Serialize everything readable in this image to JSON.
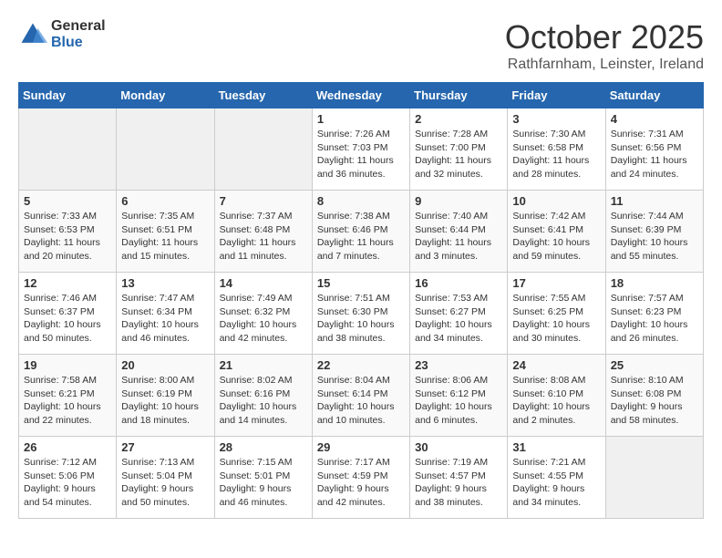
{
  "header": {
    "logo_general": "General",
    "logo_blue": "Blue",
    "month_title": "October 2025",
    "location": "Rathfarnham, Leinster, Ireland"
  },
  "days_of_week": [
    "Sunday",
    "Monday",
    "Tuesday",
    "Wednesday",
    "Thursday",
    "Friday",
    "Saturday"
  ],
  "weeks": [
    [
      {
        "num": "",
        "empty": true
      },
      {
        "num": "",
        "empty": true
      },
      {
        "num": "",
        "empty": true
      },
      {
        "num": "1",
        "sunrise": "7:26 AM",
        "sunset": "7:03 PM",
        "daylight": "11 hours and 36 minutes."
      },
      {
        "num": "2",
        "sunrise": "7:28 AM",
        "sunset": "7:00 PM",
        "daylight": "11 hours and 32 minutes."
      },
      {
        "num": "3",
        "sunrise": "7:30 AM",
        "sunset": "6:58 PM",
        "daylight": "11 hours and 28 minutes."
      },
      {
        "num": "4",
        "sunrise": "7:31 AM",
        "sunset": "6:56 PM",
        "daylight": "11 hours and 24 minutes."
      }
    ],
    [
      {
        "num": "5",
        "sunrise": "7:33 AM",
        "sunset": "6:53 PM",
        "daylight": "11 hours and 20 minutes."
      },
      {
        "num": "6",
        "sunrise": "7:35 AM",
        "sunset": "6:51 PM",
        "daylight": "11 hours and 15 minutes."
      },
      {
        "num": "7",
        "sunrise": "7:37 AM",
        "sunset": "6:48 PM",
        "daylight": "11 hours and 11 minutes."
      },
      {
        "num": "8",
        "sunrise": "7:38 AM",
        "sunset": "6:46 PM",
        "daylight": "11 hours and 7 minutes."
      },
      {
        "num": "9",
        "sunrise": "7:40 AM",
        "sunset": "6:44 PM",
        "daylight": "11 hours and 3 minutes."
      },
      {
        "num": "10",
        "sunrise": "7:42 AM",
        "sunset": "6:41 PM",
        "daylight": "10 hours and 59 minutes."
      },
      {
        "num": "11",
        "sunrise": "7:44 AM",
        "sunset": "6:39 PM",
        "daylight": "10 hours and 55 minutes."
      }
    ],
    [
      {
        "num": "12",
        "sunrise": "7:46 AM",
        "sunset": "6:37 PM",
        "daylight": "10 hours and 50 minutes."
      },
      {
        "num": "13",
        "sunrise": "7:47 AM",
        "sunset": "6:34 PM",
        "daylight": "10 hours and 46 minutes."
      },
      {
        "num": "14",
        "sunrise": "7:49 AM",
        "sunset": "6:32 PM",
        "daylight": "10 hours and 42 minutes."
      },
      {
        "num": "15",
        "sunrise": "7:51 AM",
        "sunset": "6:30 PM",
        "daylight": "10 hours and 38 minutes."
      },
      {
        "num": "16",
        "sunrise": "7:53 AM",
        "sunset": "6:27 PM",
        "daylight": "10 hours and 34 minutes."
      },
      {
        "num": "17",
        "sunrise": "7:55 AM",
        "sunset": "6:25 PM",
        "daylight": "10 hours and 30 minutes."
      },
      {
        "num": "18",
        "sunrise": "7:57 AM",
        "sunset": "6:23 PM",
        "daylight": "10 hours and 26 minutes."
      }
    ],
    [
      {
        "num": "19",
        "sunrise": "7:58 AM",
        "sunset": "6:21 PM",
        "daylight": "10 hours and 22 minutes."
      },
      {
        "num": "20",
        "sunrise": "8:00 AM",
        "sunset": "6:19 PM",
        "daylight": "10 hours and 18 minutes."
      },
      {
        "num": "21",
        "sunrise": "8:02 AM",
        "sunset": "6:16 PM",
        "daylight": "10 hours and 14 minutes."
      },
      {
        "num": "22",
        "sunrise": "8:04 AM",
        "sunset": "6:14 PM",
        "daylight": "10 hours and 10 minutes."
      },
      {
        "num": "23",
        "sunrise": "8:06 AM",
        "sunset": "6:12 PM",
        "daylight": "10 hours and 6 minutes."
      },
      {
        "num": "24",
        "sunrise": "8:08 AM",
        "sunset": "6:10 PM",
        "daylight": "10 hours and 2 minutes."
      },
      {
        "num": "25",
        "sunrise": "8:10 AM",
        "sunset": "6:08 PM",
        "daylight": "9 hours and 58 minutes."
      }
    ],
    [
      {
        "num": "26",
        "sunrise": "7:12 AM",
        "sunset": "5:06 PM",
        "daylight": "9 hours and 54 minutes."
      },
      {
        "num": "27",
        "sunrise": "7:13 AM",
        "sunset": "5:04 PM",
        "daylight": "9 hours and 50 minutes."
      },
      {
        "num": "28",
        "sunrise": "7:15 AM",
        "sunset": "5:01 PM",
        "daylight": "9 hours and 46 minutes."
      },
      {
        "num": "29",
        "sunrise": "7:17 AM",
        "sunset": "4:59 PM",
        "daylight": "9 hours and 42 minutes."
      },
      {
        "num": "30",
        "sunrise": "7:19 AM",
        "sunset": "4:57 PM",
        "daylight": "9 hours and 38 minutes."
      },
      {
        "num": "31",
        "sunrise": "7:21 AM",
        "sunset": "4:55 PM",
        "daylight": "9 hours and 34 minutes."
      },
      {
        "num": "",
        "empty": true
      }
    ]
  ]
}
